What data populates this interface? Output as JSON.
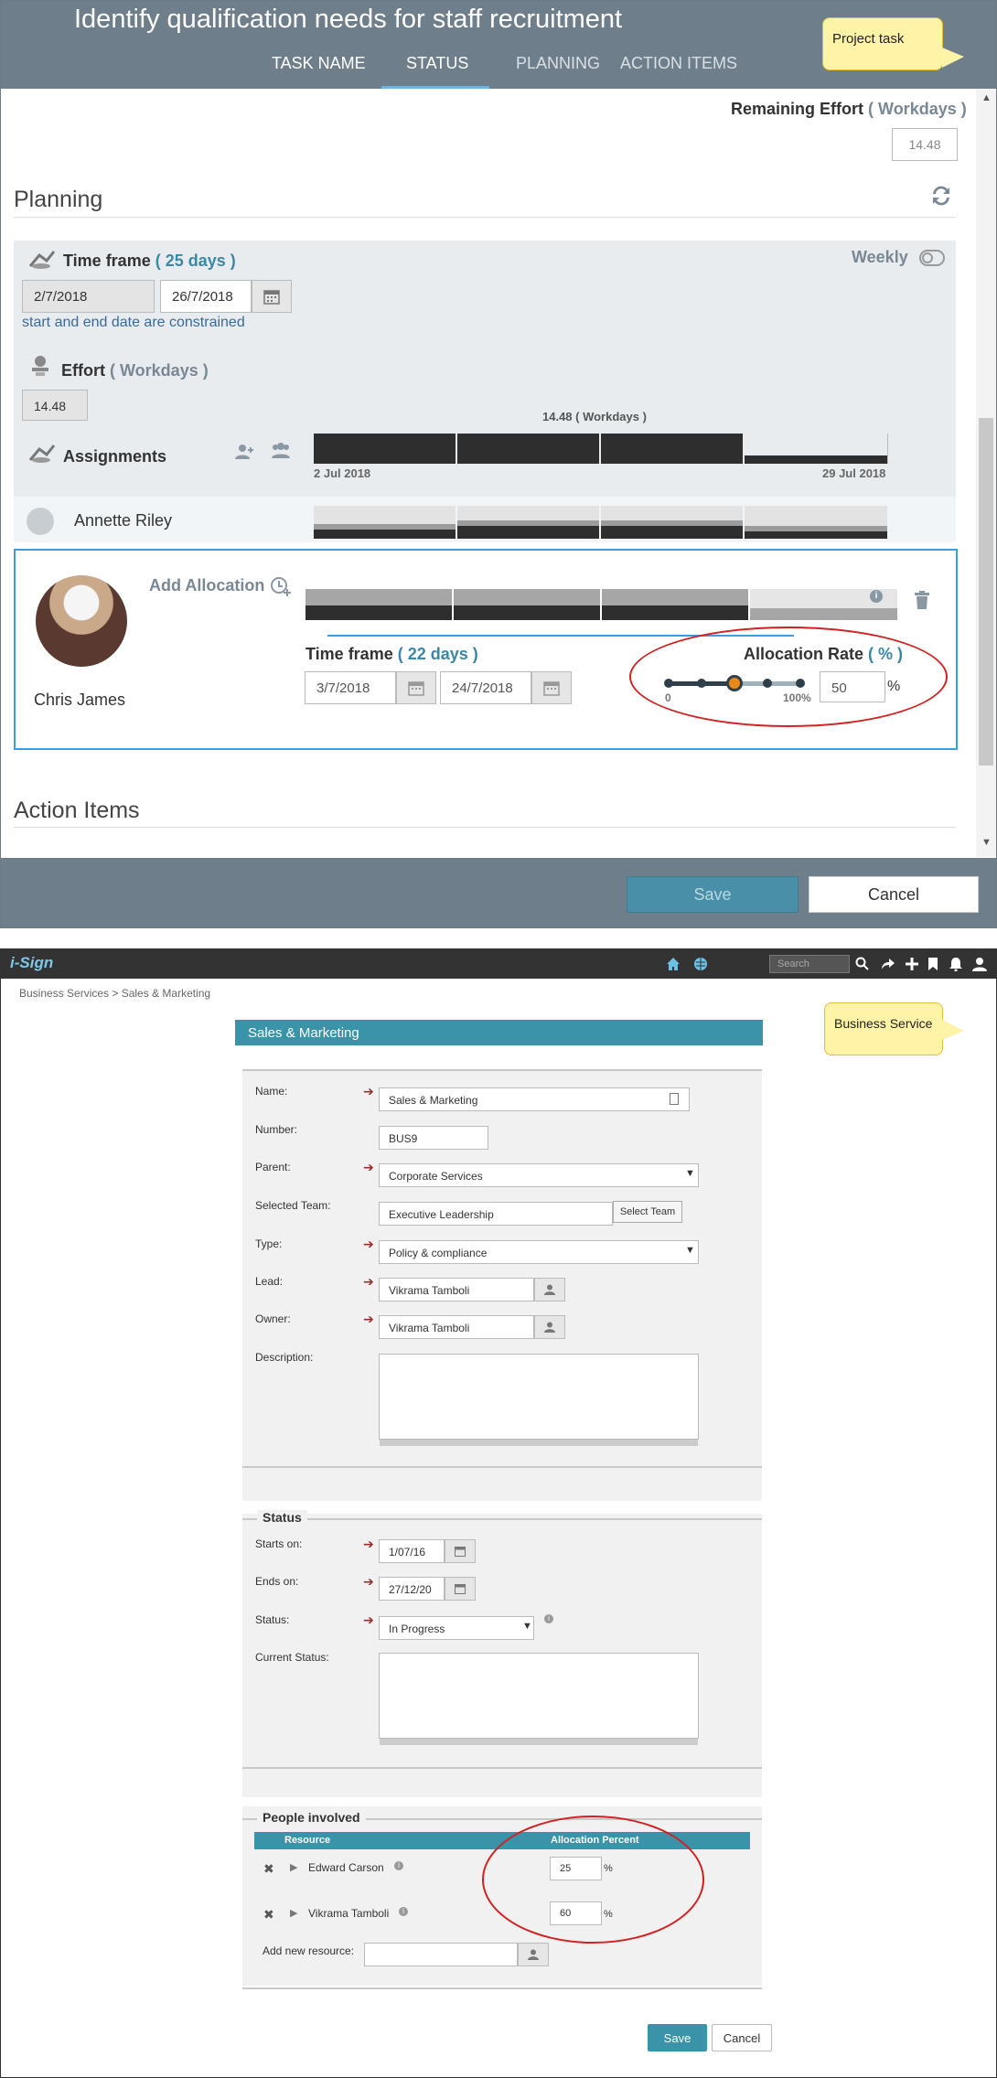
{
  "project_task": {
    "title": "Identify qualification needs for staff recruitment",
    "tabs": [
      "TASK NAME",
      "STATUS",
      "PLANNING",
      "ACTION ITEMS"
    ],
    "active_tab": "STATUS",
    "callout": "Project task",
    "remaining_effort_label": "Remaining Effort",
    "remaining_effort_unit": "( Workdays )",
    "remaining_effort_value": "14.48",
    "planning_heading": "Planning",
    "time_frame_label": "Time frame",
    "time_frame_days": "( 25 days )",
    "start_date": "2/7/2018",
    "end_date": "26/7/2018",
    "constraint_note": "start and end date are constrained",
    "weekly_label": "Weekly",
    "effort_label": "Effort",
    "effort_unit": "( Workdays )",
    "effort_value": "14.48",
    "assignments_label": "Assignments",
    "gantt_total_label": "14.48 ( Workdays )",
    "gantt_start": "2 Jul 2018",
    "gantt_end": "29 Jul 2018",
    "assignee_1": "Annette Riley",
    "add_allocation_label": "Add Allocation",
    "assignee_2": "Chris James",
    "alloc_time_frame_label": "Time frame",
    "alloc_time_frame_days": "( 22 days )",
    "alloc_start": "3/7/2018",
    "alloc_end": "24/7/2018",
    "alloc_rate_label": "Allocation Rate",
    "alloc_rate_unit": "( % )",
    "slider_min": "0",
    "slider_max": "100%",
    "alloc_rate_value": "50",
    "percent_sign": "%",
    "action_items_heading": "Action Items",
    "save_label": "Save",
    "cancel_label": "Cancel"
  },
  "business_service": {
    "logo": "i-Sign",
    "search_placeholder": "Search",
    "breadcrumb": "Business Services > Sales & Marketing",
    "header": "Sales & Marketing",
    "callout": "Business Service",
    "name_label": "Name:",
    "name_value": "Sales & Marketing",
    "number_label": "Number:",
    "number_value": "BUS9",
    "parent_label": "Parent:",
    "parent_value": "Corporate Services",
    "team_label": "Selected Team:",
    "team_value": "Executive Leadership",
    "select_team_label": "Select Team",
    "type_label": "Type:",
    "type_value": "Policy & compliance",
    "lead_label": "Lead:",
    "lead_value": "Vikrama Tamboli",
    "owner_label": "Owner:",
    "owner_value": "Vikrama Tamboli",
    "description_label": "Description:",
    "status_heading": "Status",
    "starts_label": "Starts on:",
    "starts_value": "1/07/16",
    "ends_label": "Ends on:",
    "ends_value": "27/12/20",
    "status_label": "Status:",
    "status_value": "In Progress",
    "current_status_label": "Current Status:",
    "people_heading": "People involved",
    "col_resource": "Resource",
    "col_allocation": "Allocation Percent",
    "people": [
      {
        "name": "Edward Carson",
        "percent": "25",
        "unit": "%"
      },
      {
        "name": "Vikrama Tamboli",
        "percent": "60",
        "unit": "%"
      }
    ],
    "add_resource_label": "Add new resource:",
    "save_label": "Save",
    "cancel_label": "Cancel"
  },
  "colors": {
    "header_slate": "#6e7f8b",
    "teal": "#3a93a8",
    "highlight_red": "#d42020",
    "slider_orange": "#e88a1a",
    "select_blue": "#3a9ee0"
  }
}
